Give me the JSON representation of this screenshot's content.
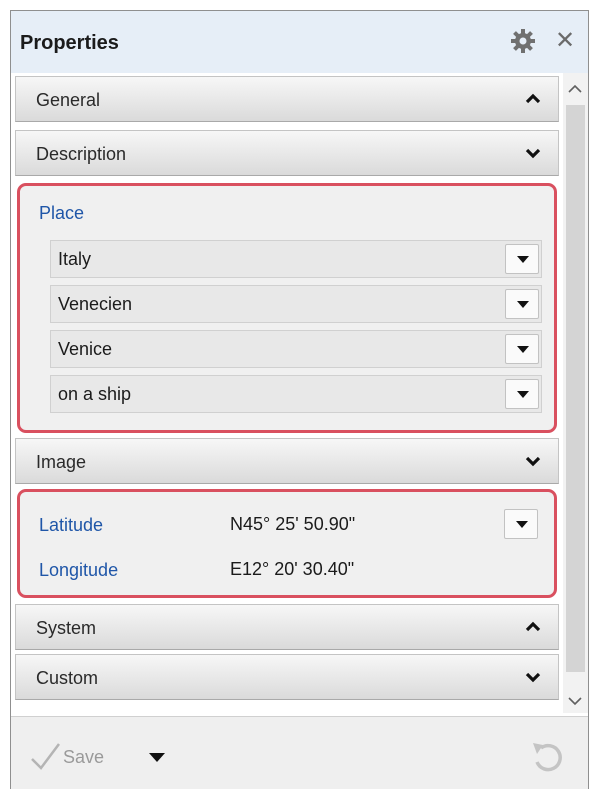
{
  "panel": {
    "title": "Properties"
  },
  "icons": {
    "settings": "gear-icon",
    "close": "close-icon",
    "save": "checkmark-icon",
    "revert": "undo-icon"
  },
  "header": {
    "close_glyph": "✕"
  },
  "sections": {
    "general": {
      "label": "General",
      "state": "expanded"
    },
    "description": {
      "label": "Description",
      "state": "collapsed"
    },
    "image": {
      "label": "Image",
      "state": "collapsed"
    },
    "system": {
      "label": "System",
      "state": "expanded"
    },
    "custom": {
      "label": "Custom",
      "state": "collapsed"
    }
  },
  "place": {
    "title": "Place",
    "fields": [
      "Italy",
      "Venecien",
      "Venice",
      "on a ship"
    ]
  },
  "geo": {
    "latitude_label": "Latitude",
    "latitude_value": "N45° 25' 50.90\"",
    "longitude_label": "Longitude",
    "longitude_value": "E12° 20' 30.40\""
  },
  "footer": {
    "save_label": "Save"
  },
  "colors": {
    "highlight_border": "#d9505f",
    "field_label": "#1f56a8",
    "header_bg": "#e6eef7"
  }
}
